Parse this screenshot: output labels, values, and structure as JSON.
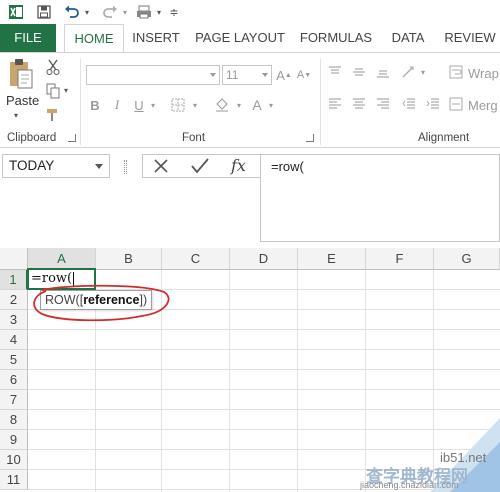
{
  "app": {
    "accent": "#217346",
    "annotation_color": "#d42a2a"
  },
  "tabs": [
    {
      "label": "FILE"
    },
    {
      "label": "HOME",
      "active": true
    },
    {
      "label": "INSERT"
    },
    {
      "label": "PAGE LAYOUT"
    },
    {
      "label": "FORMULAS"
    },
    {
      "label": "DATA"
    },
    {
      "label": "REVIEW"
    }
  ],
  "ribbon": {
    "clipboard": {
      "paste_label": "Paste",
      "group_label": "Clipboard"
    },
    "font": {
      "size_value": "11",
      "group_label": "Font"
    },
    "alignment": {
      "wrap_label": "Wrap",
      "merge_label": "Merg",
      "group_label": "Alignment"
    }
  },
  "formula_bar": {
    "name_box": "TODAY",
    "formula": "=row("
  },
  "grid": {
    "columns": [
      "A",
      "B",
      "C",
      "D",
      "E",
      "F",
      "G"
    ],
    "selected_column": "A",
    "rows": [
      "1",
      "2",
      "3",
      "4",
      "5",
      "6",
      "7",
      "8",
      "9",
      "10",
      "11"
    ],
    "selected_row": "1",
    "active_cell_value": "=row("
  },
  "tooltip": {
    "prefix": "ROW([",
    "arg": "reference",
    "suffix": "])"
  },
  "watermark": {
    "line1": "ib51.net",
    "line2": "查字典教程网",
    "line3": "jiaocheng.chazidian.com"
  }
}
